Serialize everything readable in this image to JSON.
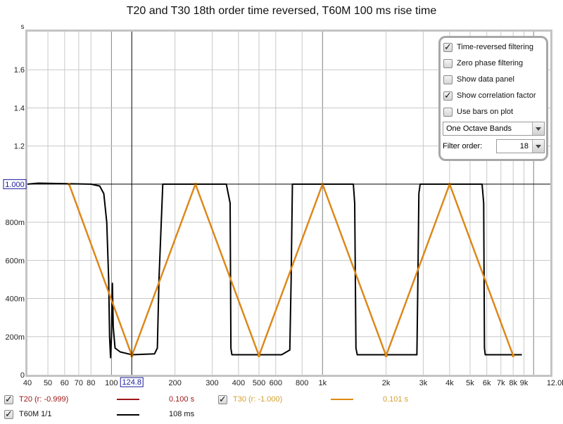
{
  "title": "T20 and T30 18th order time reversed, T60M 100 ms rise time",
  "colors": {
    "t20": "#a01818",
    "t30": "#e08a10",
    "t30_text": "#d4a030",
    "t60m": "#000000",
    "grid": "#c8c8c8",
    "cursor_box": "#1a1a9c"
  },
  "panel": {
    "options": [
      {
        "label": "Time-reversed filtering",
        "checked": true
      },
      {
        "label": "Zero phase filtering",
        "checked": false
      },
      {
        "label": "Show data panel",
        "checked": false
      },
      {
        "label": "Show correlation factor",
        "checked": true
      },
      {
        "label": "Use bars on plot",
        "checked": false
      }
    ],
    "bands_select": "One Octave Bands",
    "filter_order_label": "Filter order:",
    "filter_order_value": "18"
  },
  "legend": [
    {
      "name": "T20 (r: -0.999)",
      "checked": true,
      "value": "0.100 s",
      "series": "t20"
    },
    {
      "name": "T30 (r: -1.000)",
      "checked": true,
      "value": "0.101 s",
      "series": "t30"
    },
    {
      "name": "T60M 1/1",
      "checked": true,
      "value": "108 ms",
      "series": "t60m"
    }
  ],
  "cursor": {
    "x_label": "124.8",
    "y_label": "1.000"
  },
  "chart_data": {
    "type": "line",
    "title": "T20 and T30 18th order time reversed, T60M 100 ms rise time",
    "xlabel": "kHz",
    "ylabel": "s",
    "xscale": "log",
    "xlim": [
      40,
      12000
    ],
    "ylim": [
      0,
      1.8
    ],
    "grid": true,
    "legend_position": "bottom",
    "x_ticks": [
      40,
      50,
      60,
      70,
      80,
      100,
      200,
      300,
      400,
      500,
      600,
      800,
      1000,
      2000,
      3000,
      4000,
      5000,
      6000,
      7000,
      8000,
      9000,
      12000
    ],
    "x_tick_labels": [
      "40",
      "50",
      "60",
      "70",
      "80",
      "100",
      "200",
      "300",
      "400",
      "500",
      "600",
      "800",
      "1k",
      "2k",
      "3k",
      "4k",
      "5k",
      "6k",
      "7k",
      "8k",
      "9k",
      "12.0kHz"
    ],
    "y_ticks": [
      0,
      0.2,
      0.4,
      0.6,
      0.8,
      1.2,
      1.4,
      1.6
    ],
    "y_tick_labels": [
      "0",
      "200m",
      "400m",
      "600m",
      "800m",
      "1.2",
      "1.4",
      "1.6"
    ],
    "series": [
      {
        "name": "T30 (r: -1.000)",
        "key": "t30",
        "x": [
          63,
          125,
          250,
          500,
          1000,
          2000,
          4000,
          8000
        ],
        "y": [
          1.0,
          0.1,
          1.0,
          0.1,
          1.0,
          0.1,
          1.0,
          0.1
        ]
      },
      {
        "name": "T20 (r: -0.999)",
        "key": "t20",
        "x": [
          63,
          125,
          250,
          500,
          1000,
          2000,
          4000,
          8000
        ],
        "y": [
          1.0,
          0.1,
          1.0,
          0.1,
          1.0,
          0.1,
          1.0,
          0.1
        ]
      },
      {
        "name": "T60M 1/1",
        "key": "t60m",
        "x": [
          40,
          45,
          80,
          88,
          92,
          95,
          97,
          98,
          99,
          100,
          101,
          102,
          104,
          110,
          120,
          125,
          160,
          165,
          168,
          175,
          350,
          365,
          368,
          372,
          400,
          640,
          700,
          710,
          720,
          1400,
          1420,
          1440,
          1460,
          2800,
          2830,
          2860,
          2900,
          5700,
          5800,
          5850,
          5900,
          8800
        ],
        "y": [
          1.0,
          1.005,
          1.0,
          0.99,
          0.95,
          0.8,
          0.5,
          0.2,
          0.09,
          0.2,
          0.48,
          0.25,
          0.14,
          0.12,
          0.11,
          0.105,
          0.11,
          0.14,
          0.5,
          1.0,
          1.0,
          0.9,
          0.14,
          0.105,
          0.105,
          0.105,
          0.13,
          0.5,
          1.0,
          1.0,
          0.9,
          0.14,
          0.105,
          0.105,
          0.5,
          0.95,
          1.0,
          1.0,
          0.9,
          0.14,
          0.105,
          0.105
        ]
      }
    ]
  }
}
